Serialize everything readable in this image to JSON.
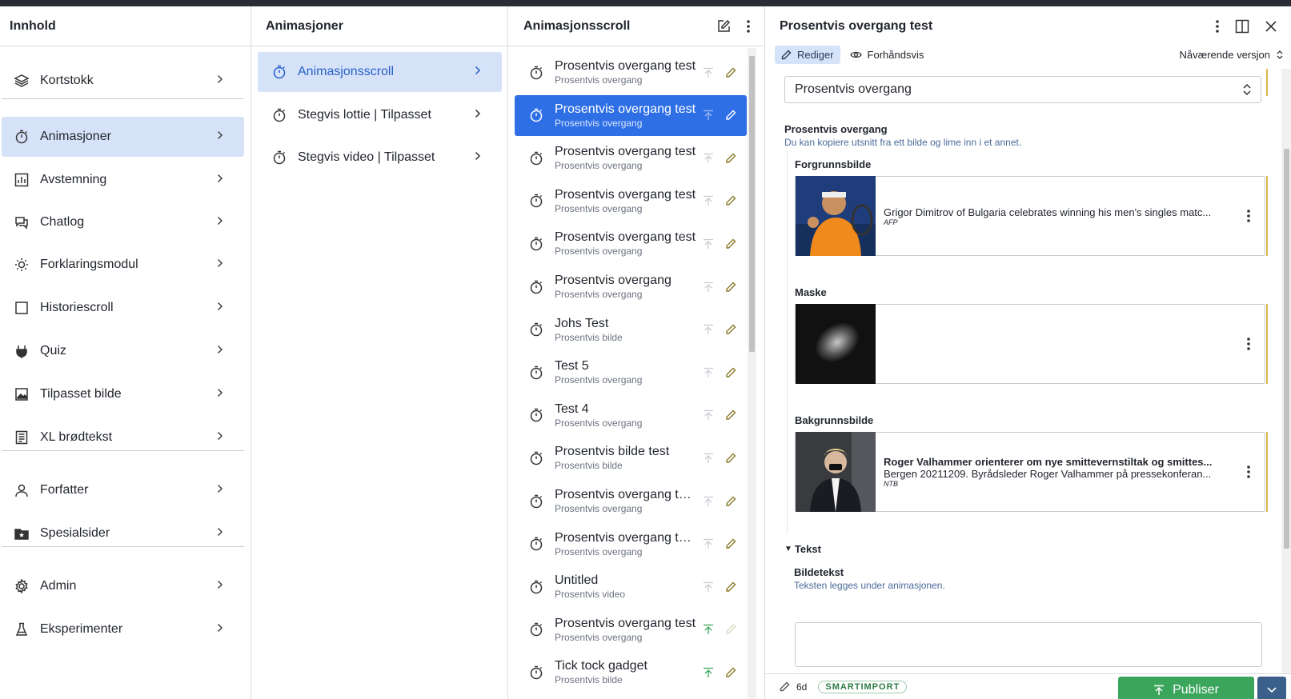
{
  "pane1": {
    "title": "Innhold",
    "items": [
      {
        "label": "Kortstokk",
        "icon": "stack-icon"
      },
      {
        "label": "Animasjoner",
        "icon": "stopwatch-icon",
        "selected": true
      },
      {
        "label": "Avstemning",
        "icon": "bar-chart-icon"
      },
      {
        "label": "Chatlog",
        "icon": "chat-icon"
      },
      {
        "label": "Forklaringsmodul",
        "icon": "bulb-icon"
      },
      {
        "label": "Historiescroll",
        "icon": "square-icon"
      },
      {
        "label": "Quiz",
        "icon": "plug-icon"
      },
      {
        "label": "Tilpasset bilde",
        "icon": "image-icon"
      },
      {
        "label": "XL brødtekst",
        "icon": "document-icon"
      },
      {
        "label": "Forfatter",
        "icon": "user-icon"
      },
      {
        "label": "Spesialsider",
        "icon": "folder-star-icon"
      },
      {
        "label": "Admin",
        "icon": "gear-icon"
      },
      {
        "label": "Eksperimenter",
        "icon": "flask-icon"
      }
    ]
  },
  "pane2": {
    "title": "Animasjoner",
    "items": [
      {
        "label": "Animasjonsscroll",
        "selected": true
      },
      {
        "label": "Stegvis lottie | Tilpasset"
      },
      {
        "label": "Stegvis video | Tilpasset"
      }
    ]
  },
  "pane3": {
    "title": "Animasjonsscroll",
    "items": [
      {
        "title": "Prosentvis overgang test",
        "subtitle": "Prosentvis overgang"
      },
      {
        "title": "Prosentvis overgang test",
        "subtitle": "Prosentvis overgang",
        "selected": true
      },
      {
        "title": "Prosentvis overgang test",
        "subtitle": "Prosentvis overgang"
      },
      {
        "title": "Prosentvis overgang test",
        "subtitle": "Prosentvis overgang"
      },
      {
        "title": "Prosentvis overgang test",
        "subtitle": "Prosentvis overgang"
      },
      {
        "title": "Prosentvis overgang",
        "subtitle": "Prosentvis overgang"
      },
      {
        "title": "Johs Test",
        "subtitle": "Prosentvis bilde"
      },
      {
        "title": "Test 5",
        "subtitle": "Prosentvis overgang"
      },
      {
        "title": "Test 4",
        "subtitle": "Prosentvis overgang"
      },
      {
        "title": "Prosentvis bilde test",
        "subtitle": "Prosentvis bilde"
      },
      {
        "title": "Prosentvis overgang tes...",
        "subtitle": "Prosentvis overgang"
      },
      {
        "title": "Prosentvis overgang tes...",
        "subtitle": "Prosentvis overgang"
      },
      {
        "title": "Untitled",
        "subtitle": "Prosentvis video"
      },
      {
        "title": "Prosentvis overgang test",
        "subtitle": "Prosentvis overgang",
        "published": true
      },
      {
        "title": "Tick tock gadget",
        "subtitle": "Prosentvis bilde",
        "published": true
      }
    ]
  },
  "editor": {
    "title": "Prosentvis overgang test",
    "tab_edit": "Rediger",
    "tab_preview": "Forhåndsvis",
    "version": "Nåværende versjon",
    "select_value": "Prosentvis overgang",
    "section_title": "Prosentvis overgang",
    "section_desc": "Du kan kopiere utsnitt fra ett bilde og lime inn i et annet.",
    "fg_label": "Forgrunnsbilde",
    "fg_caption": "Grigor Dimitrov of Bulgaria celebrates winning his men's singles matc...",
    "fg_credit": "AFP",
    "mask_label": "Maske",
    "bg_label": "Bakgrunnsbilde",
    "bg_title": "Roger Valhammer orienterer om nye smittevernstiltak og smittes...",
    "bg_caption": "Bergen 20211209. Byrådsleder Roger Valhammer på pressekonferan...",
    "bg_credit": "NTB",
    "tekst_label": "Tekst",
    "bildetekst_label": "Bildetekst",
    "bildetekst_desc": "Teksten legges under animasjonen.",
    "footer_age": "6d",
    "footer_badge": "SMARTIMPORT",
    "publish": "Publiser"
  },
  "colors": {
    "accent": "#2f6fe6",
    "selected_bg": "#d6e2f8",
    "publish": "#3ba55c",
    "gold": "#e0b84a"
  }
}
